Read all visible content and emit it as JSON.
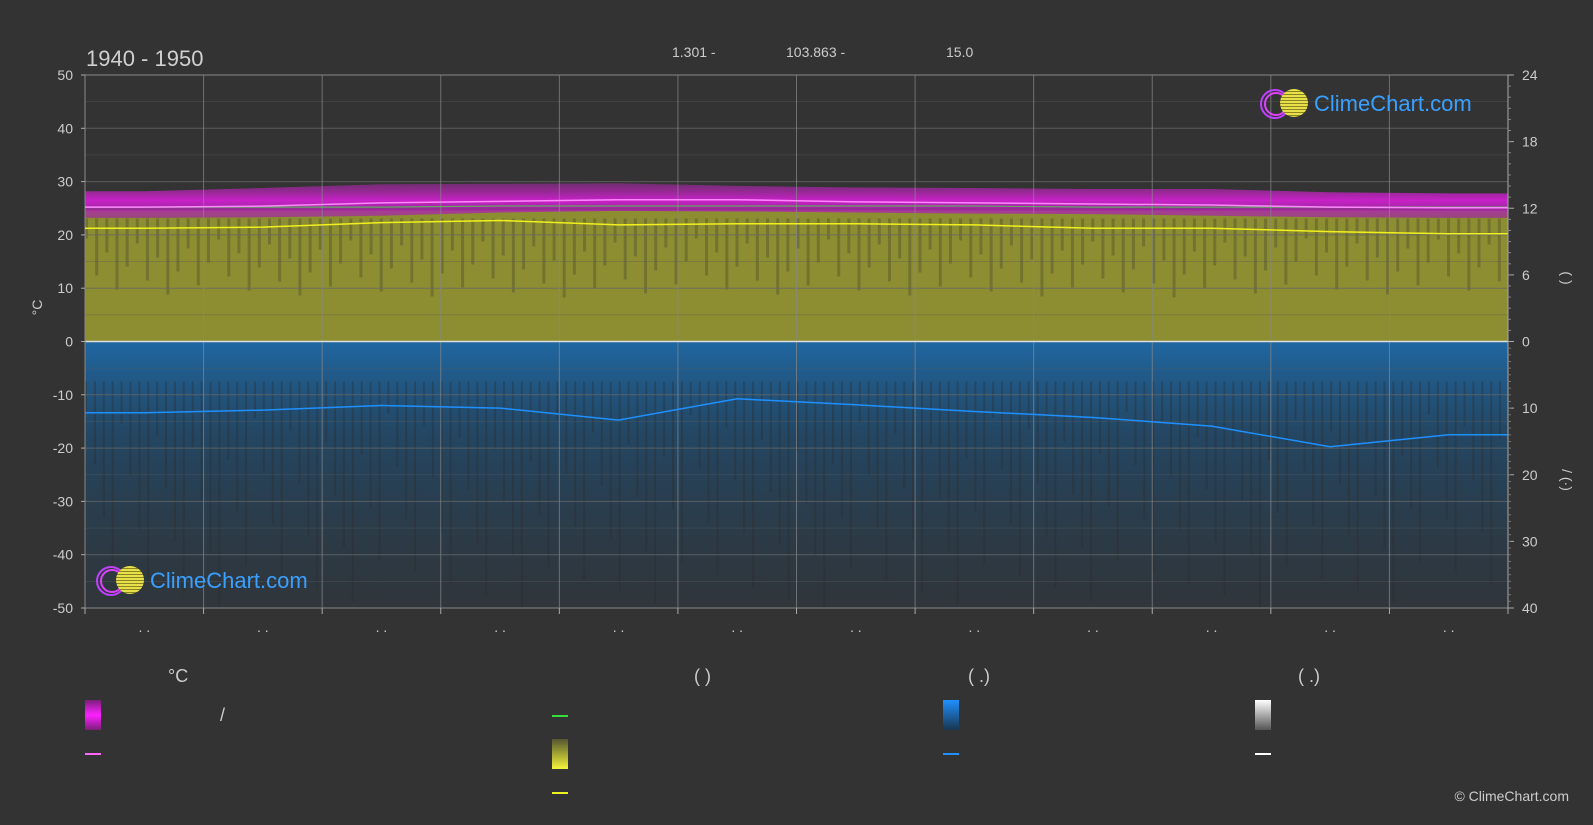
{
  "header": {
    "period": "1940 - 1950",
    "latitude": "1.301 -",
    "longitude": "103.863 -",
    "elevation": "15.0"
  },
  "logo": {
    "text": "ClimeChart.com"
  },
  "copyright": "© ClimeChart.com",
  "colors": {
    "background": "#333333",
    "temp_band": "#d020d0",
    "temp_line": "#ff88ff",
    "sun_band": "#b0b030",
    "sun_line": "#f0f020",
    "daylight_line": "#44dd44",
    "precip_band": "#1e6aa8",
    "precip_line": "#1e90ff",
    "snow_line": "#ffffff",
    "grid": "#666666",
    "accent": "#3aa0ff"
  },
  "chart_data": {
    "type": "area",
    "title": "",
    "left_axis": {
      "label": "°C",
      "ticks": [
        "50",
        "40",
        "30",
        "20",
        "10",
        "0",
        "-10",
        "-20",
        "-30",
        "-40",
        "-50"
      ],
      "ylim": [
        -50,
        50
      ]
    },
    "right_axis_sun": {
      "ticks": [
        "24",
        "18",
        "12",
        "6",
        "0"
      ],
      "ylim": [
        0,
        24
      ],
      "label_fragment": "(   )"
    },
    "right_axis_precip": {
      "ticks": [
        "10",
        "20",
        "30",
        "40"
      ],
      "ylim": [
        0,
        40
      ],
      "label_fragment": "/ (·)"
    },
    "months": 12,
    "x_tick_marks": [
      ". .",
      ". .",
      ". .",
      ". .",
      ". .",
      ". .",
      ". .",
      ". .",
      ". .",
      ". .",
      ". .",
      ". ."
    ],
    "series": [
      {
        "key": "temp_mean",
        "values": [
          25.2,
          25.4,
          26.0,
          26.3,
          26.6,
          26.6,
          26.2,
          26.0,
          25.8,
          25.6,
          25.2,
          25.1
        ]
      },
      {
        "key": "temp_band_max",
        "values": [
          28.2,
          28.8,
          29.5,
          29.6,
          29.7,
          29.2,
          28.9,
          28.8,
          28.6,
          28.6,
          28.0,
          27.8
        ]
      },
      {
        "key": "temp_band_min",
        "values": [
          23.2,
          23.3,
          23.6,
          24.2,
          24.5,
          24.4,
          24.2,
          24.0,
          23.9,
          23.6,
          23.3,
          23.2
        ]
      },
      {
        "key": "sunshine_hours",
        "values": [
          10.2,
          10.3,
          10.7,
          10.9,
          10.5,
          10.6,
          10.6,
          10.5,
          10.2,
          10.2,
          9.9,
          9.7
        ]
      },
      {
        "key": "daylight_hours",
        "values": [
          12.1,
          12.1,
          12.1,
          12.2,
          12.2,
          12.2,
          12.2,
          12.2,
          12.1,
          12.1,
          12.1,
          12.1
        ]
      },
      {
        "key": "precip_mean",
        "values": [
          10.7,
          10.3,
          9.6,
          10.0,
          11.8,
          8.6,
          9.5,
          10.5,
          11.4,
          12.7,
          15.8,
          14.0
        ]
      },
      {
        "key": "snow_mean",
        "values": [
          0,
          0,
          0,
          0,
          0,
          0,
          0,
          0,
          0,
          0,
          0,
          0
        ]
      }
    ]
  },
  "legend": {
    "col1": {
      "head": "°C",
      "item1_sep": "/"
    },
    "col2": {
      "head": "(          )"
    },
    "col3": {
      "head": "(   .)"
    },
    "col4": {
      "head": "(   .)"
    }
  }
}
